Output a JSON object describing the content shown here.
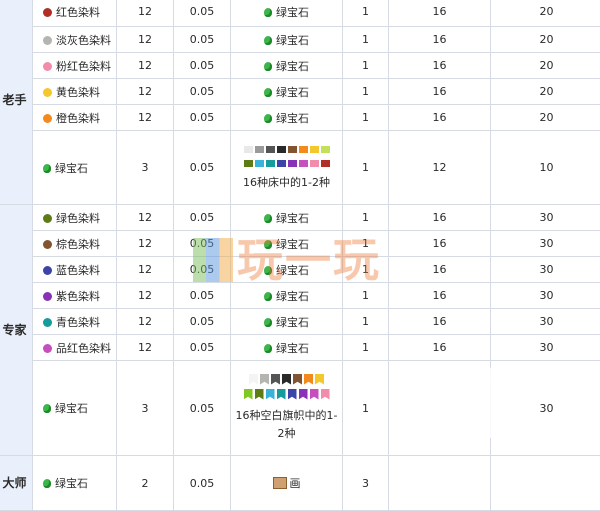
{
  "levels": {
    "novice": "老手",
    "expert": "专家",
    "master": "大师"
  },
  "rows": [
    {
      "item": "红色染料",
      "dye": "#b02e26",
      "qty": "12",
      "mult": "0.05",
      "price": "绿宝石",
      "price_qty": "1",
      "uses": "16",
      "xp": "20"
    },
    {
      "item": "淡灰色染料",
      "dye": "#b4b4b0",
      "qty": "12",
      "mult": "0.05",
      "price": "绿宝石",
      "price_qty": "1",
      "uses": "16",
      "xp": "20"
    },
    {
      "item": "粉红色染料",
      "dye": "#f38baa",
      "qty": "12",
      "mult": "0.05",
      "price": "绿宝石",
      "price_qty": "1",
      "uses": "16",
      "xp": "20"
    },
    {
      "item": "黄色染料",
      "dye": "#f4c82d",
      "qty": "12",
      "mult": "0.05",
      "price": "绿宝石",
      "price_qty": "1",
      "uses": "16",
      "xp": "20"
    },
    {
      "item": "橙色染料",
      "dye": "#f28a1d",
      "qty": "12",
      "mult": "0.05",
      "price": "绿宝石",
      "price_qty": "1",
      "uses": "16",
      "xp": "20"
    },
    {
      "item": "绿宝石",
      "qty": "3",
      "mult": "0.05",
      "desc": "16种床中的1-2种",
      "price_qty": "1",
      "uses": "12",
      "xp": "10"
    },
    {
      "item": "绿色染料",
      "dye": "#5e7c16",
      "qty": "12",
      "mult": "0.05",
      "price": "绿宝石",
      "price_qty": "1",
      "uses": "16",
      "xp": "30"
    },
    {
      "item": "棕色染料",
      "dye": "#835432",
      "qty": "12",
      "mult": "0.05",
      "price": "绿宝石",
      "price_qty": "1",
      "uses": "16",
      "xp": "30"
    },
    {
      "item": "蓝色染料",
      "dye": "#3c44aa",
      "qty": "12",
      "mult": "0.05",
      "price": "绿宝石",
      "price_qty": "1",
      "uses": "16",
      "xp": "30"
    },
    {
      "item": "紫色染料",
      "dye": "#8932b8",
      "qty": "12",
      "mult": "0.05",
      "price": "绿宝石",
      "price_qty": "1",
      "uses": "16",
      "xp": "30"
    },
    {
      "item": "青色染料",
      "dye": "#169c9c",
      "qty": "12",
      "mult": "0.05",
      "price": "绿宝石",
      "price_qty": "1",
      "uses": "16",
      "xp": "30"
    },
    {
      "item": "品红色染料",
      "dye": "#c74ebd",
      "qty": "12",
      "mult": "0.05",
      "price": "绿宝石",
      "price_qty": "1",
      "uses": "16",
      "xp": "30"
    },
    {
      "item": "绿宝石",
      "qty": "3",
      "mult": "0.05",
      "desc": "16种空白旗帜中的1-2种",
      "price_qty": "1",
      "uses": "12",
      "xp": "30"
    },
    {
      "item": "绿宝石",
      "qty": "2",
      "mult": "0.05",
      "price": "画",
      "price_qty": "3",
      "uses": "",
      "xp": ""
    }
  ],
  "bed_colors_row1": [
    "#e8e8e8",
    "#9a9a9a",
    "#555555",
    "#2a2a2a",
    "#835432",
    "#f28a1d",
    "#f4c82d",
    "#c2e05a"
  ],
  "bed_colors_row2": [
    "#5e7c16",
    "#3ab3da",
    "#169c9c",
    "#3c44aa",
    "#8932b8",
    "#c74ebd",
    "#f38baa",
    "#b02e26"
  ],
  "banner_colors_row1": [
    "#f4f4f4",
    "#b4b4b0",
    "#555555",
    "#2a2a2a",
    "#835432",
    "#f28a1d",
    "#f4c82d"
  ],
  "banner_colors_row2": [
    "#80c71f",
    "#5e7c16",
    "#3ab3da",
    "#169c9c",
    "#3c44aa",
    "#8932b8",
    "#c74ebd",
    "#f38baa"
  ],
  "watermark": "玩一玩"
}
